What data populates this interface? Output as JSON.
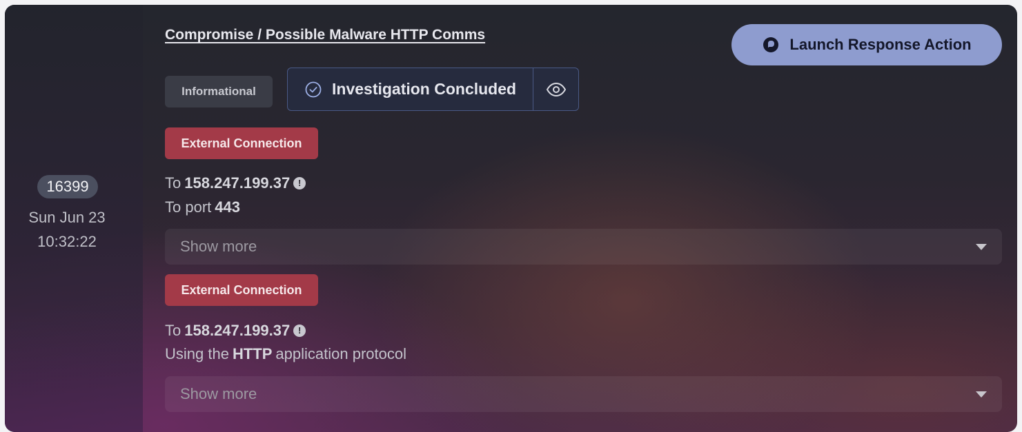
{
  "event": {
    "id": "16399",
    "date": "Sun Jun 23",
    "time": "10:32:22"
  },
  "title": "Compromise / Possible Malware HTTP Comms",
  "launch_button": {
    "label": "Launch Response Action",
    "icon": "response-bubble-icon"
  },
  "severity_badge": "Informational",
  "status": {
    "label": "Investigation Concluded",
    "icon": "check-circle-icon",
    "toggle_icon": "eye-icon"
  },
  "details": [
    {
      "tag": "External Connection",
      "line1_prefix": "To",
      "line1_value": "158.247.199.37",
      "line2_prefix": "To port",
      "line2_value": "443",
      "line2_suffix": "",
      "show_more": "Show more"
    },
    {
      "tag": "External Connection",
      "line1_prefix": "To",
      "line1_value": "158.247.199.37",
      "line2_prefix": "Using the",
      "line2_value": "HTTP",
      "line2_suffix": "application protocol",
      "show_more": "Show more"
    }
  ],
  "colors": {
    "accent_button": "#8e9ccf",
    "tag_red": "#a33a48",
    "status_border": "#4a5a86"
  }
}
